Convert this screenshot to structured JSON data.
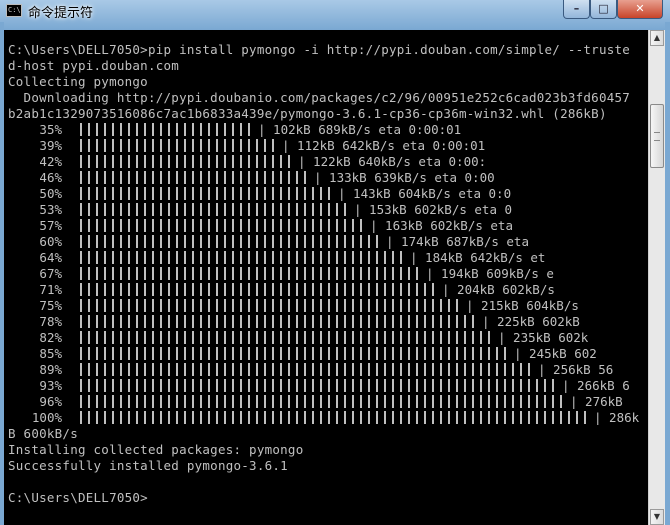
{
  "window": {
    "title": "命令提示符",
    "icon": "console-icon",
    "buttons": {
      "minimize": "–",
      "maximize": "□",
      "close": "✕"
    }
  },
  "console": {
    "lines_top": [
      "C:\\Users\\DELL7050>pip install pymongo -i http://pypi.douban.com/simple/ --truste",
      "d-host pypi.douban.com",
      "Collecting pymongo",
      "  Downloading http://pypi.doubanio.com/packages/c2/96/00951e252c6cad023b3fd60457",
      "b2ab1c1329073516086c7ac1b6833a439e/pymongo-3.6.1-cp36-cp36m-win32.whl (286kB)"
    ],
    "progress": [
      {
        "pct": "35%",
        "fraction": 0.35,
        "stat": "| 102kB 689kB/s eta 0:00:01"
      },
      {
        "pct": "39%",
        "fraction": 0.39,
        "stat": "| 112kB 642kB/s eta 0:00:01"
      },
      {
        "pct": "42%",
        "fraction": 0.42,
        "stat": "| 122kB 640kB/s eta 0:00:"
      },
      {
        "pct": "46%",
        "fraction": 0.46,
        "stat": "| 133kB 639kB/s eta 0:00"
      },
      {
        "pct": "50%",
        "fraction": 0.5,
        "stat": "| 143kB 604kB/s eta 0:0"
      },
      {
        "pct": "53%",
        "fraction": 0.53,
        "stat": "| 153kB 602kB/s eta 0"
      },
      {
        "pct": "57%",
        "fraction": 0.57,
        "stat": "| 163kB 602kB/s eta"
      },
      {
        "pct": "60%",
        "fraction": 0.6,
        "stat": "| 174kB 687kB/s eta"
      },
      {
        "pct": "64%",
        "fraction": 0.64,
        "stat": "| 184kB 642kB/s et"
      },
      {
        "pct": "67%",
        "fraction": 0.67,
        "stat": "| 194kB 609kB/s e"
      },
      {
        "pct": "71%",
        "fraction": 0.71,
        "stat": "| 204kB 602kB/s"
      },
      {
        "pct": "75%",
        "fraction": 0.75,
        "stat": "| 215kB 604kB/s"
      },
      {
        "pct": "78%",
        "fraction": 0.78,
        "stat": "| 225kB 602kB"
      },
      {
        "pct": "82%",
        "fraction": 0.82,
        "stat": "| 235kB 602k"
      },
      {
        "pct": "85%",
        "fraction": 0.85,
        "stat": "| 245kB 602"
      },
      {
        "pct": "89%",
        "fraction": 0.89,
        "stat": "| 256kB 56"
      },
      {
        "pct": "93%",
        "fraction": 0.93,
        "stat": "| 266kB 6"
      },
      {
        "pct": "96%",
        "fraction": 0.96,
        "stat": "| 276kB"
      },
      {
        "pct": "100%",
        "fraction": 1.0,
        "stat": "| 286k"
      }
    ],
    "lines_bottom": [
      "B 600kB/s",
      "Installing collected packages: pymongo",
      "Successfully installed pymongo-3.6.1",
      "",
      "C:\\Users\\DELL7050>"
    ],
    "colors": {
      "background": "#000000",
      "text": "#c0c0c0"
    }
  }
}
